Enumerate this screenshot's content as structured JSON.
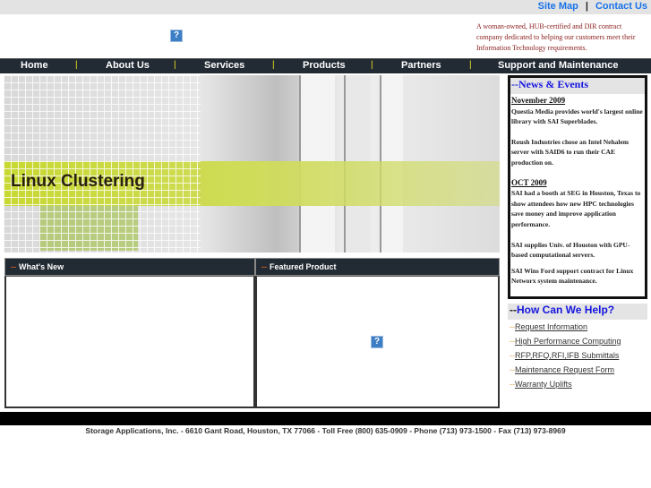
{
  "top": {
    "site_map": "Site Map",
    "separator": "|",
    "contact_us": "Contact Us"
  },
  "header": {
    "tagline": "A woman-owned, HUB-certified and DIR contract company dedicated to helping our customers meet their Information Technology requirements.",
    "broken_image": "?"
  },
  "nav": {
    "items": [
      "Home",
      "About Us",
      "Services",
      "Products",
      "Partners",
      "Support and Maintenance"
    ],
    "separator": "|"
  },
  "banner": {
    "title": "Linux Clustering"
  },
  "news": {
    "title": "--News & Events",
    "sections": [
      {
        "month": "November 2009",
        "items": [
          "Questia Media provides world's largest online library with SAI Superblades.",
          "Roush Industries chose an Intel Nehalem server with SAID6 to run their CAE production on."
        ]
      },
      {
        "month": "OCT 2009",
        "items": [
          "SAI had a booth at SEG in Houston, Texas to show attendees how new HPC technologies save money and improve application performance.",
          "SAI supplies Univ. of Houston with GPU-based computational servers.",
          "SAI Wins Ford support contract for Linux Networx system maintenance."
        ]
      }
    ]
  },
  "panels": {
    "whats_new": "What's New",
    "featured": "Featured Product",
    "dash": "--"
  },
  "help": {
    "dashes": "--",
    "title": "How Can We Help?",
    "links": [
      "Request Information",
      "High Performance Computing",
      "RFP,RFQ,RFI,IFB Submittals",
      "Maintenance Request Form",
      "Warranty Uplifts"
    ]
  },
  "footer": {
    "text": "Storage Applications, Inc. - 6610 Gant Road, Houston, TX 77066 - Toll Free (800) 635-0909 - Phone (713) 973-1500 - Fax (713) 973-8969"
  },
  "colors": {
    "nav_bg": "#222a33",
    "link_blue": "#1a73e8",
    "heading_blue": "#1515e0",
    "tagline_red": "#8a1c1c",
    "band_green": "#c8d832"
  }
}
